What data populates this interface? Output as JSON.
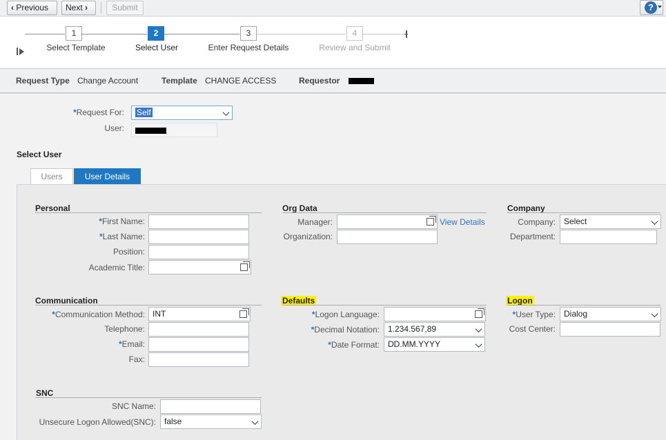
{
  "toolbar": {
    "previous_label": "Previous",
    "next_label": "Next",
    "submit_label": "Submit",
    "help_label": "?"
  },
  "roadmap": {
    "steps": [
      {
        "num": "1",
        "label": "Select Template",
        "state": "done"
      },
      {
        "num": "2",
        "label": "Select User",
        "state": "active"
      },
      {
        "num": "3",
        "label": "Enter Request Details",
        "state": "next"
      },
      {
        "num": "4",
        "label": "Review and Submit",
        "state": "future"
      }
    ]
  },
  "info": {
    "request_type_label": "Request Type",
    "request_type_value": "Change Account",
    "template_label": "Template",
    "template_value": "CHANGE ACCESS",
    "requestor_label": "Requestor"
  },
  "request": {
    "request_for_label": "Request For:",
    "request_for_value": "Self",
    "user_label": "User:"
  },
  "select_user_title": "Select User",
  "tabs": {
    "users": "Users",
    "user_details": "User Details"
  },
  "personal": {
    "title": "Personal",
    "first_name_label": "First Name:",
    "last_name_label": "Last Name:",
    "position_label": "Position:",
    "academic_title_label": "Academic Title:"
  },
  "org": {
    "title": "Org Data",
    "manager_label": "Manager:",
    "view_details": "View Details",
    "organization_label": "Organization:"
  },
  "company": {
    "title": "Company",
    "company_label": "Company:",
    "company_value": "Select",
    "department_label": "Department:"
  },
  "communication": {
    "title": "Communication",
    "method_label": "Communication Method:",
    "method_value": "INT",
    "telephone_label": "Telephone:",
    "email_label": "Email:",
    "fax_label": "Fax:"
  },
  "defaults": {
    "title": "Defaults",
    "logon_language_label": "Logon Language:",
    "decimal_label": "Decimal Notation:",
    "decimal_value": "1.234.567,89",
    "date_label": "Date Format:",
    "date_value": "DD.MM.YYYY"
  },
  "logon": {
    "title": "Logon",
    "user_type_label": "User Type:",
    "user_type_value": "Dialog",
    "cost_center_label": "Cost Center:"
  },
  "snc": {
    "title": "SNC",
    "name_label": "SNC Name:",
    "unsecure_label": "Unsecure Logon Allowed(SNC):",
    "unsecure_value": "false"
  },
  "colors": {
    "accent": "#1f78c4",
    "required": "#2b72c8",
    "highlight": "#fff200"
  }
}
